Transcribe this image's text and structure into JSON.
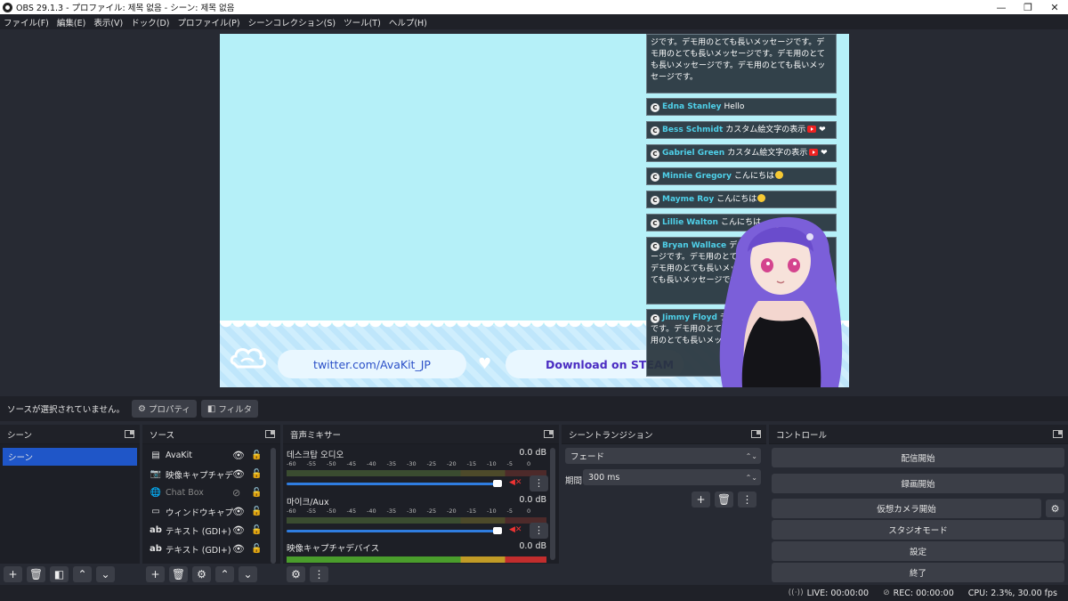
{
  "window": {
    "title": "OBS 29.1.3 - プロファイル: 제목 없음 - シーン: 제목 없음"
  },
  "menu": [
    "ファイル(F)",
    "編集(E)",
    "表示(V)",
    "ドック(D)",
    "プロファイル(P)",
    "シーンコレクション(S)",
    "ツール(T)",
    "ヘルプ(H)"
  ],
  "preview": {
    "twitter": "twitter.com/AvaKit_JP",
    "download": "Download on STEAM",
    "chat": [
      {
        "author": "",
        "text": "ジです。デモ用のとても長いメッセージです。デモ用のとても長いメッセージです。デモ用のとても長いメッセージです。デモ用のとても長いメッセージです。"
      },
      {
        "author": "Edna Stanley",
        "text": "Hello"
      },
      {
        "author": "Bess Schmidt",
        "text": "カスタム絵文字の表示"
      },
      {
        "author": "Gabriel Green",
        "text": "カスタム絵文字の表示"
      },
      {
        "author": "Minnie Gregory",
        "text": "こんにちは"
      },
      {
        "author": "Mayme Roy",
        "text": "こんにちは"
      },
      {
        "author": "Lillie Walton",
        "text": "こんにちは"
      },
      {
        "author": "Bryan Wallace",
        "text": "デモ用のとても長いメッセージです。デモ用のとても長いメッセージです。デモ用のとても長いメッセージです。デモ用のとても長いメッセージです。"
      },
      {
        "author": "Jimmy Floyd",
        "text": "デモ用のとても長いメッセージです。デモ用のとても長いメッセージです。デモ用のとても長いメッセージです。"
      }
    ]
  },
  "infobar": {
    "status": "ソースが選択されていません。",
    "properties": "プロパティ",
    "filters": "フィルタ"
  },
  "docks": {
    "scenes": {
      "title": "シーン",
      "items": [
        "シーン"
      ]
    },
    "sources": {
      "title": "ソース",
      "items": [
        {
          "name": "AvaKit",
          "icon": "file-icon",
          "visible": true
        },
        {
          "name": "映像キャプチャデバイス",
          "icon": "camera-icon",
          "visible": true
        },
        {
          "name": "Chat Box",
          "icon": "browser-icon",
          "visible": false
        },
        {
          "name": "ウィンドウキャプチャ",
          "icon": "window-icon",
          "visible": true
        },
        {
          "name": "テキスト (GDI+) 2",
          "icon": "text-icon",
          "visible": true
        },
        {
          "name": "テキスト (GDI+)",
          "icon": "text-icon",
          "visible": true
        }
      ]
    },
    "mixer": {
      "title": "音声ミキサー",
      "channels": [
        {
          "name": "데스크탑 오디오",
          "db": "0.0 dB",
          "level": 1.0,
          "muted": true
        },
        {
          "name": "마이크/Aux",
          "db": "0.0 dB",
          "level": 1.0,
          "muted": true
        },
        {
          "name": "映像キャプチャデバイス",
          "db": "0.0 dB",
          "level": 1.0,
          "muted": false
        }
      ],
      "scale": [
        "-60",
        "-55",
        "-50",
        "-45",
        "-40",
        "-35",
        "-30",
        "-25",
        "-20",
        "-15",
        "-10",
        "-5",
        "0"
      ]
    },
    "transition": {
      "title": "シーントランジション",
      "selected": "フェード",
      "duration_label": "期間",
      "duration": "300 ms"
    },
    "controls": {
      "title": "コントロール",
      "start_stream": "配信開始",
      "start_record": "録画開始",
      "start_vcam": "仮想カメラ開始",
      "studio_mode": "スタジオモード",
      "settings": "設定",
      "exit": "終了"
    }
  },
  "statusbar": {
    "live": "LIVE: 00:00:00",
    "rec": "REC: 00:00:00",
    "cpu": "CPU: 2.3%, 30.00 fps"
  },
  "colors": {
    "accent": "#1f56c8",
    "panel": "#272a33",
    "dark": "#1d1f26",
    "button": "#3b3e47"
  }
}
